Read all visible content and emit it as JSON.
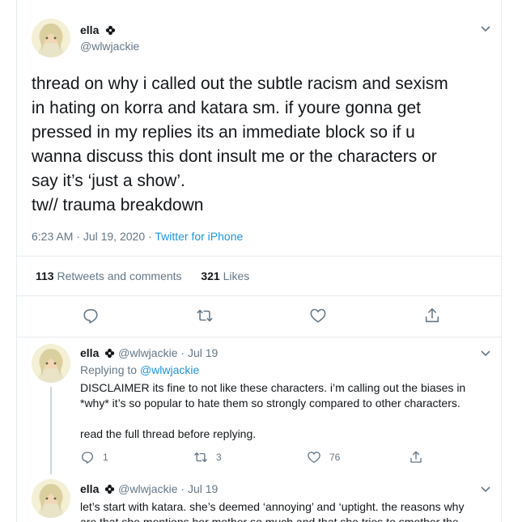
{
  "colors": {
    "accent": "#1b95e0",
    "muted": "#657786",
    "text": "#14171a",
    "border": "#e6ecf0"
  },
  "tweet": {
    "display_name": "ella",
    "badge_icon": "flower-icon",
    "handle": "@wlwjackie",
    "text": "thread on why i called out the subtle racism and sexism\nin hating on korra and katara sm. if youre gonna get\npressed in my replies its an immediate block so if u\nwanna discuss this dont insult me or the characters or\nsay it’s ‘just a show’.\ntw// trauma breakdown",
    "time": "6:23 AM",
    "date": "Jul 19, 2020",
    "source": "Twitter for iPhone",
    "retweets_count": "113",
    "retweets_label": "Retweets and comments",
    "likes_count": "321",
    "likes_label": "Likes",
    "actions": [
      "reply-icon",
      "retweet-icon",
      "like-icon",
      "share-icon"
    ]
  },
  "replies": [
    {
      "display_name": "ella",
      "handle": "@wlwjackie",
      "date": "Jul 19",
      "replying_prefix": "Replying to",
      "replying_to": "@wlwjackie",
      "text": "DISCLAIMER its fine to not like these characters. i’m calling out the biases in\n*why* it’s so popular to hate them so strongly compared to other characters.\n\nread the full thread before replying.",
      "reply_count": "1",
      "retweet_count": "3",
      "like_count": "76"
    },
    {
      "display_name": "ella",
      "handle": "@wlwjackie",
      "date": "Jul 19",
      "text": "let’s start with katara. she’s deemed ‘annoying’ and ‘uptight. the reasons why\nare that she mentions her mother so much and that she tries to smother the"
    }
  ]
}
